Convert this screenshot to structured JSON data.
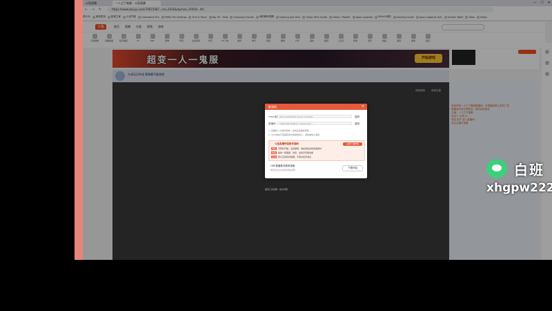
{
  "browser": {
    "tabs": [
      "斗鱼直播",
      "一人之下鬼服 - 斗鱼直播"
    ],
    "url": "https://www.douyu.com/7461508?...rid=3516&dyshid=1f3f39...#0",
    "bookmarks": [
      "导航卡片",
      "新标签页",
      "影视之家",
      "小说书架",
      "Overwatch Pro",
      "PUBG Pro Settings",
      "Find A Trove",
      "Top 50 - Prod",
      "Company Events",
      "我的腾讯视频",
      "Gaming and tech",
      "Origin Tech Guide",
      "Home / Twitter",
      "Apex Legends",
      "Bilibili 我的",
      "Gaming Guide",
      "Apex Legends Hub",
      "Tracker Table",
      "Sites",
      "Video"
    ]
  },
  "site": {
    "logo": "斗鱼",
    "nav": [
      "首页",
      "直播",
      "分类",
      "视频",
      "游戏"
    ],
    "categories": [
      "王者荣耀",
      "英雄联盟",
      "和平精英",
      "CF",
      "DNF",
      "原神",
      "传奇",
      "主机游戏",
      "炉石",
      "QQ飞车",
      "魔兽",
      "体育",
      "综合",
      "看球",
      "户外",
      "美食",
      "颜值",
      "二次元",
      "科技",
      "音乐",
      "舞蹈",
      "语音",
      "星秀",
      "更多"
    ]
  },
  "banner": {
    "title": "超变一人一鬼服",
    "button": "开始游戏"
  },
  "room": {
    "title": "九成无吕布流 套装解不能游戏"
  },
  "player": {
    "btn_a": "弹幕屏蔽",
    "btn_b": "弹幕设置"
  },
  "chat_lines": [
    "欢迎来到一人之下鬼服直播间，本直播间禁止发布广告",
    "直播间内请文明发言，遵守相关规定",
    "主播：一人之下鬼服",
    "送出了 礼物 x1",
    "欢迎 用户 进入直播间",
    "关注主播不迷路"
  ],
  "dialog": {
    "title": "推流码",
    "server_label": "rtmp地址：",
    "server_value": "rtmp://sendtc3a.douyu.com/live",
    "key_label": "直播码：",
    "key_value": "7461508rcWd8dc...&txSecret=...",
    "copy_label": "复制",
    "note_1": "1. 直播码 5 分钟内有效，失效后请重新获取",
    "note_2": "2. rtmp地址与直播码请勿泄露给他人，避免被他人盗用",
    "tips_title": "斗鱼直播伴侣新手福利",
    "tips_button": "立即下载伴侣",
    "tips": [
      {
        "tag": "特权",
        "text": "可预约开播、设置弹幕、快捷添加多种直播素材"
      },
      {
        "tag": "技能",
        "text": "提供一键美颜、滤镜、虚拟背景等功能"
      },
      {
        "tag": "互动",
        "text": "观众互动实时提醒，不错过任何消息"
      }
    ],
    "footer_title": "OBS直播推流使用指南",
    "footer_sub": "推流成功后请保持网络通畅",
    "footer_button": "下载伴侣"
  },
  "under_dialog": "推流工具说明 · 常见问题",
  "watermark": {
    "cn": "白班",
    "en": "xhgpw222"
  }
}
